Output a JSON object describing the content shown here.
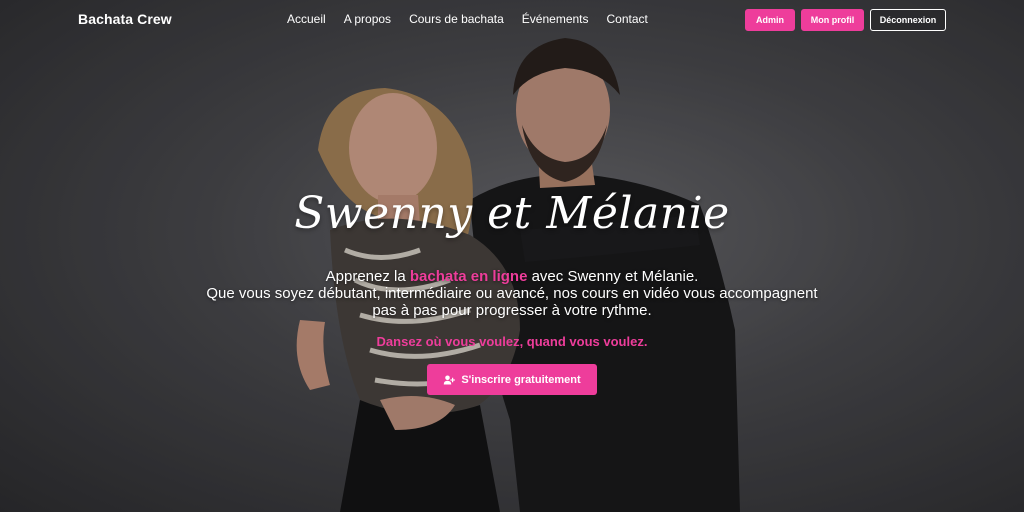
{
  "brand": "Bachata Crew",
  "nav": {
    "items": [
      "Accueil",
      "A propos",
      "Cours de bachata",
      "Événements",
      "Contact"
    ],
    "admin_label": "Admin",
    "profile_label": "Mon profil",
    "logout_label": "Déconnexion"
  },
  "hero": {
    "title": "Swenny et Mélanie",
    "lead_before": "Apprenez la ",
    "lead_highlight": "bachata en ligne",
    "lead_after": " avec Swenny et Mélanie.",
    "lead_line2": "Que vous soyez débutant, intermédiaire ou avancé, nos cours en vidéo vous accompagnent",
    "lead_line3": "pas à pas pour progresser à votre rythme.",
    "tagline": "Dansez où vous voulez, quand vous voulez.",
    "cta_label": "S'inscrire gratuitement",
    "cta_icon": "user-plus-icon"
  },
  "colors": {
    "accent": "#ee3d9b",
    "text": "#ffffff"
  }
}
